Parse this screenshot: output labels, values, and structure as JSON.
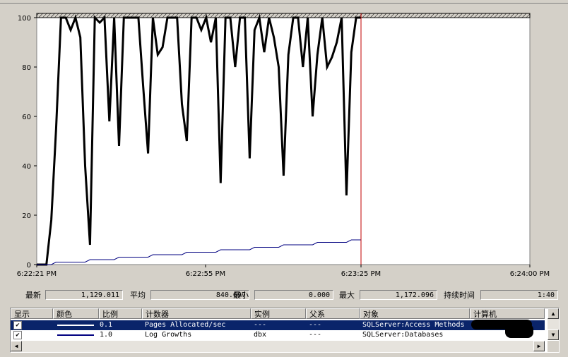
{
  "chart_data": {
    "type": "line",
    "ylim": [
      0,
      100
    ],
    "y_ticks": [
      "100",
      "80",
      "60",
      "40",
      "20",
      "0"
    ],
    "x_tick_labels": [
      "6:22:21 PM",
      "6:22:55 PM",
      "6:23:25 PM",
      "6:24:00 PM"
    ],
    "time_cursor": "6:23:25 PM",
    "grid": false,
    "series": [
      {
        "color": "#000000",
        "values": [
          0,
          0,
          0,
          18,
          55,
          100,
          100,
          95,
          100,
          92,
          40,
          8,
          100,
          98,
          100,
          58,
          100,
          48,
          100,
          100,
          100,
          100,
          72,
          45,
          100,
          85,
          88,
          100,
          100,
          100,
          65,
          50,
          100,
          100,
          95,
          100,
          90,
          100,
          33,
          100,
          100,
          80,
          100,
          100,
          43,
          95,
          100,
          86,
          100,
          92,
          80,
          36,
          85,
          100,
          100,
          80,
          100,
          60,
          85,
          100,
          80,
          84,
          90,
          100,
          28,
          86,
          100,
          100
        ],
        "line_width": 3
      },
      {
        "color": "#000080",
        "values": [
          0,
          0,
          0,
          0,
          1,
          1,
          1,
          1,
          1,
          1,
          1,
          2,
          2,
          2,
          2,
          2,
          2,
          3,
          3,
          3,
          3,
          3,
          3,
          3,
          4,
          4,
          4,
          4,
          4,
          4,
          4,
          5,
          5,
          5,
          5,
          5,
          5,
          5,
          6,
          6,
          6,
          6,
          6,
          6,
          6,
          7,
          7,
          7,
          7,
          7,
          7,
          8,
          8,
          8,
          8,
          8,
          8,
          8,
          9,
          9,
          9,
          9,
          9,
          9,
          9,
          10,
          10,
          10
        ],
        "line_width": 1
      }
    ]
  },
  "stats": {
    "last_label": "最新",
    "last_value": "1,129.011",
    "avg_label": "平均",
    "avg_value": "840.697",
    "min_label": "最小",
    "min_value": "0.000",
    "max_label": "最大",
    "max_value": "1,172.096",
    "duration_label": "持续时间",
    "duration_value": "1:40"
  },
  "counters": {
    "headers": [
      "显示",
      "颜色",
      "比例",
      "计数器",
      "实例",
      "父系",
      "对象",
      "计算机"
    ],
    "rows": [
      {
        "checked": "✔",
        "color": "#ffffff",
        "scale": "0.1",
        "counter": "Pages Allocated/sec",
        "instance": "---",
        "parent": "---",
        "object": "SQLServer:Access Methods",
        "computer": ""
      },
      {
        "checked": "✔",
        "color": "#000080",
        "scale": "1.0",
        "counter": "Log Growths",
        "instance": "dbx",
        "parent": "---",
        "object": "SQLServer:Databases",
        "computer": ""
      }
    ]
  },
  "icons": {
    "scroll_up": "up-arrow-icon",
    "scroll_down": "down-arrow-icon",
    "scroll_left": "left-arrow-icon",
    "scroll_right": "right-arrow-icon",
    "check": "checkmark-icon"
  }
}
